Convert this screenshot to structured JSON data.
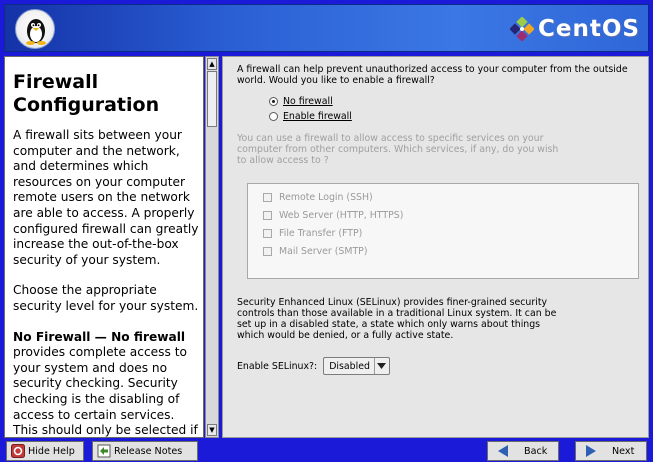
{
  "banner": {
    "brand_name": "CentOS",
    "logo_icon": "tux-penguin-icon",
    "brand_icon": "centos-symbol-icon"
  },
  "help": {
    "title": "Firewall Configuration",
    "paragraphs": [
      "A firewall sits between your computer and the network, and determines which resources on your computer remote users on the network are able to access. A properly configured firewall can greatly increase the out-of-the-box security of your system.",
      "Choose the appropriate security level for your system."
    ],
    "last_paragraph_bold": "No Firewall — No firewall",
    "last_paragraph_rest": " provides complete access to your system and does no security checking. Security checking is the disabling of access to certain services. This should only be selected if you are running on a trusted"
  },
  "main": {
    "intro": "A firewall can help prevent unauthorized access to your computer from the outside world.  Would you like to enable a firewall?",
    "radio_no_firewall": "No firewall",
    "radio_enable_firewall": "Enable firewall",
    "selected_option": "No firewall",
    "services_description": "You can use a firewall to allow access to specific services on your computer from other computers. Which services, if any, do you wish to allow access to ?",
    "services": [
      "Remote Login (SSH)",
      "Web Server (HTTP, HTTPS)",
      "File Transfer (FTP)",
      "Mail Server (SMTP)"
    ],
    "selinux_description": "Security Enhanced Linux (SELinux) provides finer-grained security controls than those available in a traditional Linux system.  It can be set up in a disabled state, a state which only warns about things which would be denied, or a fully active state.",
    "selinux_label": "Enable SELinux?:",
    "selinux_value": "Disabled"
  },
  "buttons": {
    "hide_help": "Hide Help",
    "release_notes": "Release Notes",
    "back": "Back",
    "next": "Next"
  },
  "colors": {
    "background": "#1a1ad8",
    "panel": "#e6e6e6",
    "disabled_text": "#a0a0a0"
  }
}
